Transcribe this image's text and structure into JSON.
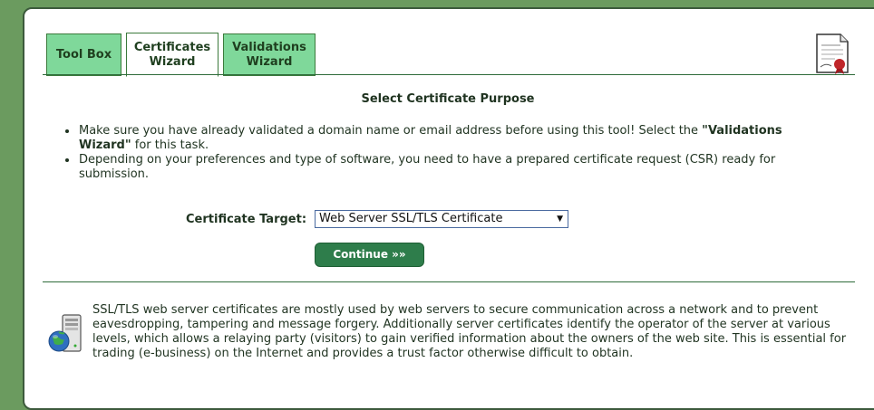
{
  "tabs": [
    {
      "label_line1": "Tool Box",
      "label_line2": ""
    },
    {
      "label_line1": "Certificates",
      "label_line2": "Wizard"
    },
    {
      "label_line1": "Validations",
      "label_line2": "Wizard"
    }
  ],
  "icons": {
    "certificate": "certificate-icon",
    "server": "server-globe-icon"
  },
  "colors": {
    "background": "#6b9b5f",
    "tab_inactive": "#7fd89a",
    "button": "#2e7d4b",
    "text": "#1f3320"
  },
  "main": {
    "heading": "Select Certificate Purpose",
    "bullet1_pre": "Make sure you have already validated a domain name or email address before using this tool! Select the ",
    "bullet1_bold": "\"Validations Wizard\"",
    "bullet1_post": " for this task.",
    "bullet2": "Depending on your preferences and type of software, you need to have a prepared certificate request (CSR) ready for submission.",
    "target_label": "Certificate Target:",
    "target_selected": "Web Server SSL/TLS Certificate",
    "continue_label": "Continue »»"
  },
  "info": {
    "text": "SSL/TLS web server certificates are mostly used by web servers to secure communication across a network and to prevent eavesdropping, tampering and message forgery. Additionally server certificates identify the operator of the server at various levels, which allows a relaying party (visitors) to gain verified information about the owners of the web site. This is essential for trading (e-business) on the Internet and provides a trust factor otherwise difficult to obtain."
  }
}
